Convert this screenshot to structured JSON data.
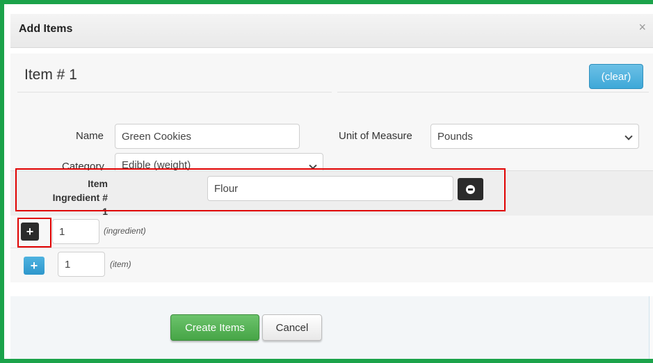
{
  "dialog": {
    "title": "Add Items",
    "close_glyph": "×"
  },
  "item": {
    "heading": "Item # 1",
    "clear_label": "(clear)",
    "name_label": "Name",
    "name_value": "Green Cookies",
    "category_label": "Category",
    "category_value": "Edible (weight)",
    "uom_label": "Unit of Measure",
    "uom_value": "Pounds"
  },
  "ingredient": {
    "label_line1": "Item",
    "label_line2": "Ingredient # 1",
    "value": "Flour",
    "remove_icon": "minus-circle-icon"
  },
  "add_ingredient": {
    "icon": "plus-icon",
    "plus_glyph": "+",
    "count": "1",
    "hint": "(ingredient)"
  },
  "add_item": {
    "icon": "plus-icon",
    "plus_glyph": "+",
    "count": "1",
    "hint": "(item)"
  },
  "footer": {
    "create_label": "Create Items",
    "cancel_label": "Cancel"
  },
  "colors": {
    "frame_border": "#1ba34a",
    "highlight_box": "#e00000",
    "clear_button": "#3ea8d8",
    "create_button": "#46a546"
  }
}
